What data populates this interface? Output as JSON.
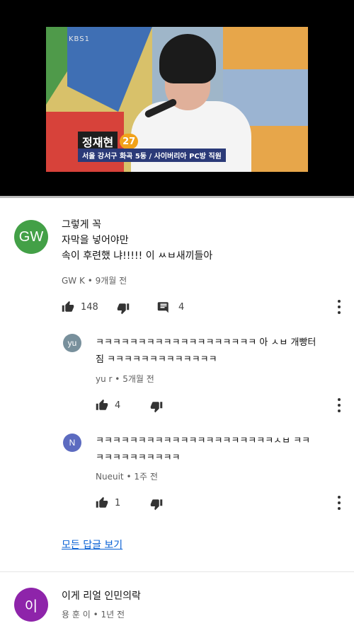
{
  "video": {
    "channel_logo": "KBS1",
    "caption_name": "정재현",
    "caption_age": "27",
    "caption_subtitle": "서울 강서구 화곡 5동 / 사이버리아 PC방 직원",
    "progress": 0.0,
    "progress_color": "#e53935"
  },
  "comments": [
    {
      "avatar_text": "GW",
      "avatar_color": "#43a047",
      "text": "그렇게 꼭\n자막을 넣어야만\n속이 후련했  냐!!!!! 이 ㅆㅂ새끼들아",
      "author": "GW K",
      "time": "9개월 전",
      "likes": "148",
      "reply_count": "4"
    },
    {
      "avatar_text": "yu",
      "avatar_color": "#78909c",
      "text": "ㅋㅋㅋㅋㅋㅋㅋㅋㅋㅋㅋㅋㅋㅋㅋㅋㅋㅋㅋ 아 ㅅㅂ 개빵터\n짐 ㅋㅋㅋㅋㅋㅋㅋㅋㅋㅋㅋㅋㅋ",
      "author": "yu r",
      "time": "5개월 전",
      "likes": "4"
    },
    {
      "avatar_text": "N",
      "avatar_color": "#5c6bc0",
      "text": "ㅋㅋㅋㅋㅋㅋㅋㅋㅋㅋㅋㅋㅋㅋㅋㅋㅋㅋㅋㅋㅋㅅㅂ ㅋㅋ\nㅋㅋㅋㅋㅋㅋㅋㅋㅋㅋ",
      "author": "Nueuit",
      "time": "1주 전",
      "likes": "1"
    },
    {
      "avatar_text": "이",
      "avatar_color": "#8e24aa",
      "text": "이게 리얼 인민의락",
      "author": "용 훈 이",
      "time": "1년 전"
    }
  ],
  "view_all_replies": "모든 답글 보기",
  "icons": {
    "like": "thumbs-up-icon",
    "dislike": "thumbs-down-icon",
    "reply": "comment-icon",
    "more": "more-vert-icon"
  }
}
